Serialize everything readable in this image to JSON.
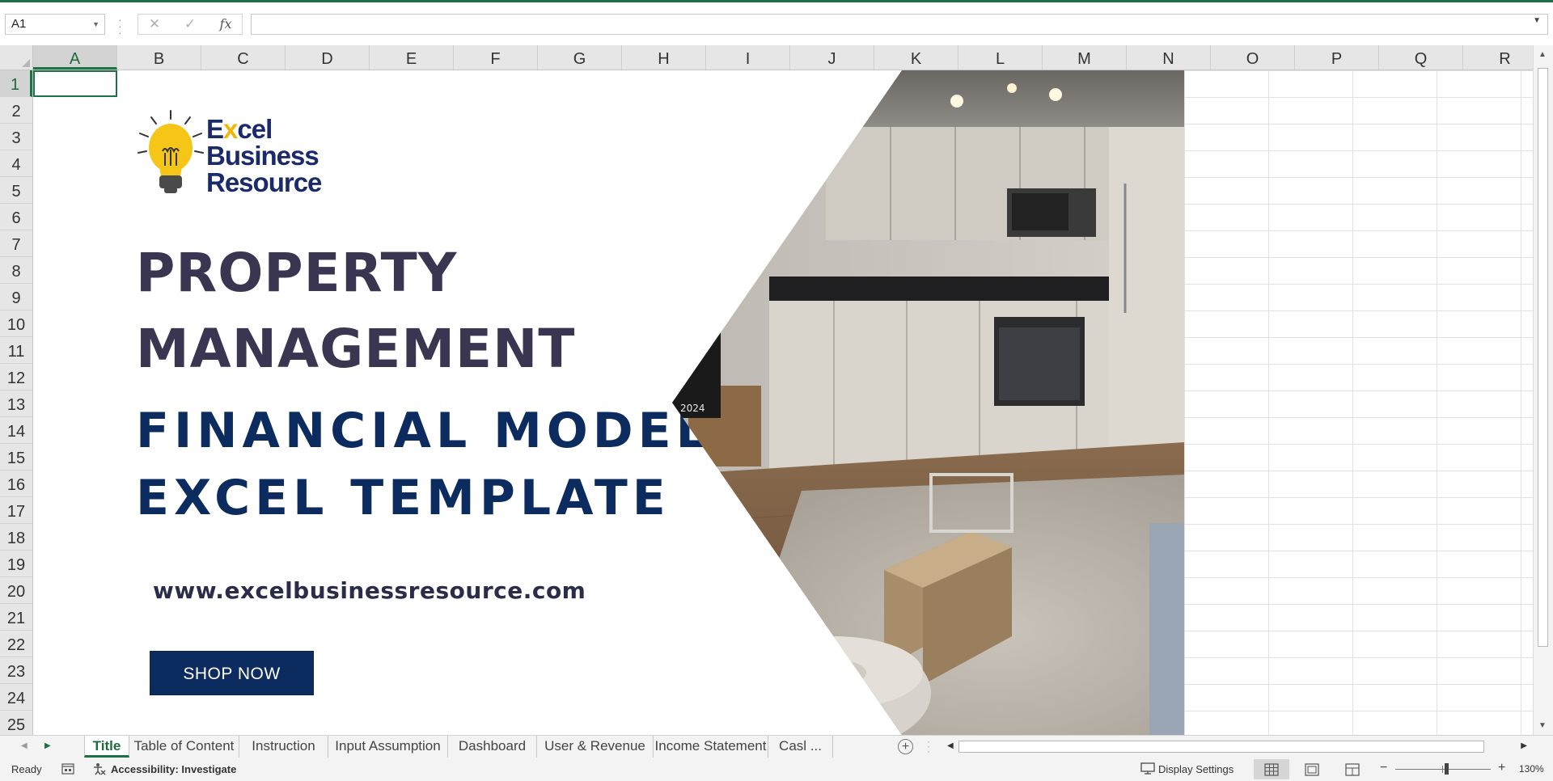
{
  "formula_bar": {
    "name_box": "A1",
    "fx_label": "fx",
    "cancel_glyph": "✕",
    "enter_glyph": "✓",
    "formula_value": ""
  },
  "columns": [
    "A",
    "B",
    "C",
    "D",
    "E",
    "F",
    "G",
    "H",
    "I",
    "J",
    "K",
    "L",
    "M",
    "N",
    "O",
    "P",
    "Q",
    "R"
  ],
  "rows": [
    "1",
    "2",
    "3",
    "4",
    "5",
    "6",
    "7",
    "8",
    "9",
    "10",
    "11",
    "12",
    "13",
    "14",
    "15",
    "16",
    "17",
    "18",
    "19",
    "20",
    "21",
    "22",
    "23",
    "24",
    "25"
  ],
  "active_cell": {
    "column": "A",
    "row": "1"
  },
  "banner": {
    "logo": {
      "line1_prefix": "E",
      "line1_x": "x",
      "line1_suffix": "cel",
      "line2": "Business",
      "line3": "Resource"
    },
    "title_line1": "PROPERTY",
    "title_line2": "MANAGEMENT",
    "subtitle_line1": "FINANCIAL MODEL",
    "subtitle_line2": "EXCEL TEMPLATE",
    "website": "www.excelbusinessresource.com",
    "cta_label": "SHOP NOW",
    "photo_watermark": "2024"
  },
  "sheet_tabs": [
    {
      "label": "Title",
      "active": true
    },
    {
      "label": "Table of Content",
      "active": false
    },
    {
      "label": "Instruction",
      "active": false
    },
    {
      "label": "Input Assumption",
      "active": false
    },
    {
      "label": "Dashboard",
      "active": false
    },
    {
      "label": "User & Revenue",
      "active": false
    },
    {
      "label": "Income Statement",
      "active": false
    },
    {
      "label": "Casl ...",
      "active": false
    }
  ],
  "status_bar": {
    "ready": "Ready",
    "accessibility": "Accessibility: Investigate",
    "display_settings": "Display Settings",
    "zoom": "130%"
  },
  "colors": {
    "excel_green": "#1e7145",
    "navy": "#0c2b5e",
    "title_dark": "#3a3550",
    "logo_yellow": "#f2b705"
  }
}
